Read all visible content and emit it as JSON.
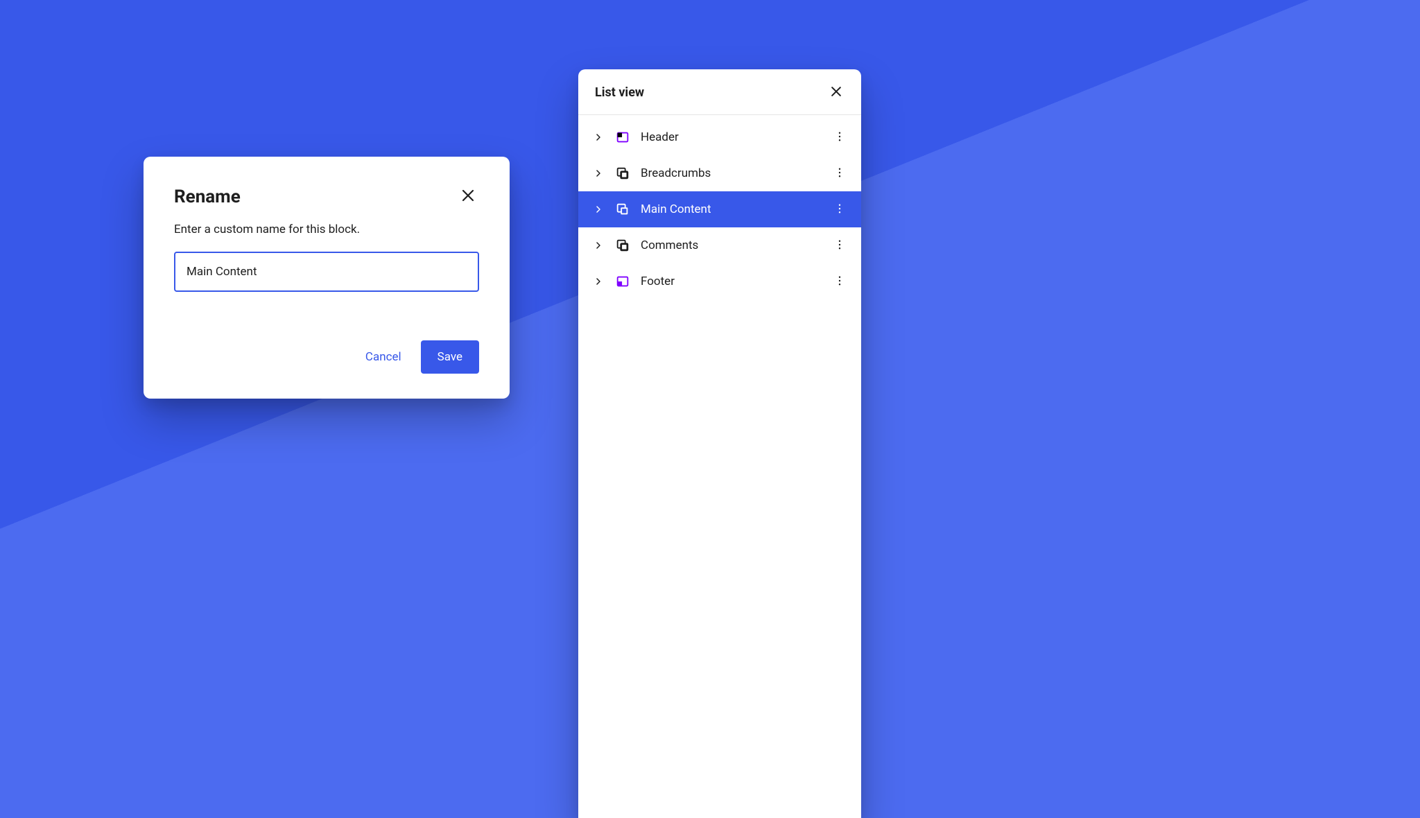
{
  "colors": {
    "brand": "#3858E9",
    "brand_light": "#4C6BF0",
    "icon_purple": "#7F00FF",
    "text": "#1e1e1e"
  },
  "dialog": {
    "title": "Rename",
    "description": "Enter a custom name for this block.",
    "input_value": "Main Content",
    "cancel_label": "Cancel",
    "save_label": "Save"
  },
  "panel": {
    "title": "List view",
    "items": [
      {
        "label": "Header",
        "icon": "section-header-icon",
        "selected": false
      },
      {
        "label": "Breadcrumbs",
        "icon": "group-icon",
        "selected": false
      },
      {
        "label": "Main Content",
        "icon": "group-icon",
        "selected": true
      },
      {
        "label": "Comments",
        "icon": "group-icon",
        "selected": false
      },
      {
        "label": "Footer",
        "icon": "section-footer-icon",
        "selected": false
      }
    ]
  }
}
